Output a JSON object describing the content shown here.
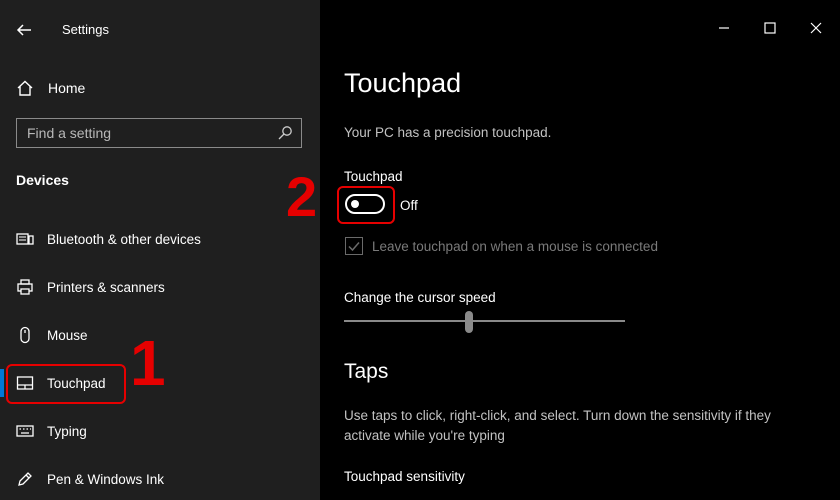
{
  "window": {
    "title": "Settings"
  },
  "sidebar": {
    "home_label": "Home",
    "search": {
      "placeholder": "Find a setting"
    },
    "section_title": "Devices",
    "items": [
      {
        "label": "Bluetooth & other devices",
        "icon": "bluetooth-devices-icon"
      },
      {
        "label": "Printers & scanners",
        "icon": "printer-icon"
      },
      {
        "label": "Mouse",
        "icon": "mouse-icon"
      },
      {
        "label": "Touchpad",
        "icon": "touchpad-icon",
        "active": true
      },
      {
        "label": "Typing",
        "icon": "keyboard-icon"
      },
      {
        "label": "Pen & Windows Ink",
        "icon": "pen-icon"
      }
    ]
  },
  "main": {
    "title": "Touchpad",
    "subtitle": "Your PC has a precision touchpad.",
    "touchpad_label": "Touchpad",
    "toggle": {
      "state_text": "Off",
      "on": false
    },
    "checkbox": {
      "label": "Leave touchpad on when a mouse is connected",
      "checked": true,
      "enabled": false
    },
    "cursor_speed_label": "Change the cursor speed",
    "cursor_speed_fraction": 0.5,
    "taps_title": "Taps",
    "taps_description": "Use taps to click, right-click, and select. Turn down the sensitivity if they activate while you're typing",
    "sensitivity_label": "Touchpad sensitivity"
  },
  "annotations": {
    "marker_1": "1",
    "marker_2": "2",
    "color": "#e60000"
  },
  "colors": {
    "accent": "#0078d7",
    "sidebar_bg": "#1f1f1f",
    "main_bg": "#000000"
  }
}
